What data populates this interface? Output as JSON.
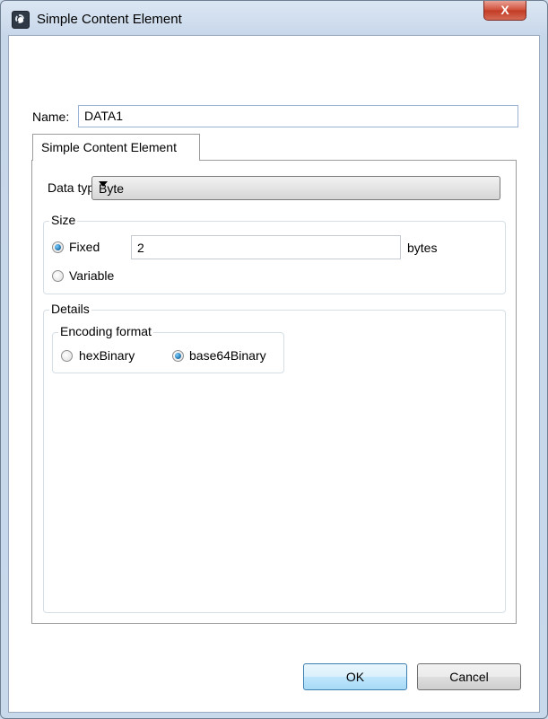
{
  "window": {
    "title": "Simple Content Element",
    "close_glyph": "X"
  },
  "form": {
    "name_label": "Name:",
    "name_value": "DATA1"
  },
  "tab": {
    "label": "Simple Content Element"
  },
  "data_type": {
    "label": "Data type:",
    "value": "Byte"
  },
  "size": {
    "title": "Size",
    "fixed_label": "Fixed",
    "fixed_selected": true,
    "fixed_value": "2",
    "unit": "bytes",
    "variable_label": "Variable"
  },
  "details": {
    "title": "Details",
    "encoding": {
      "title": "Encoding format",
      "options": [
        {
          "label": "hexBinary",
          "selected": false
        },
        {
          "label": "base64Binary",
          "selected": true
        }
      ]
    }
  },
  "buttons": {
    "ok": "OK",
    "cancel": "Cancel"
  },
  "colors": {
    "accent": "#1c6fa8",
    "title_gradient": "#c9d9ec",
    "close_red": "#c23a24"
  }
}
